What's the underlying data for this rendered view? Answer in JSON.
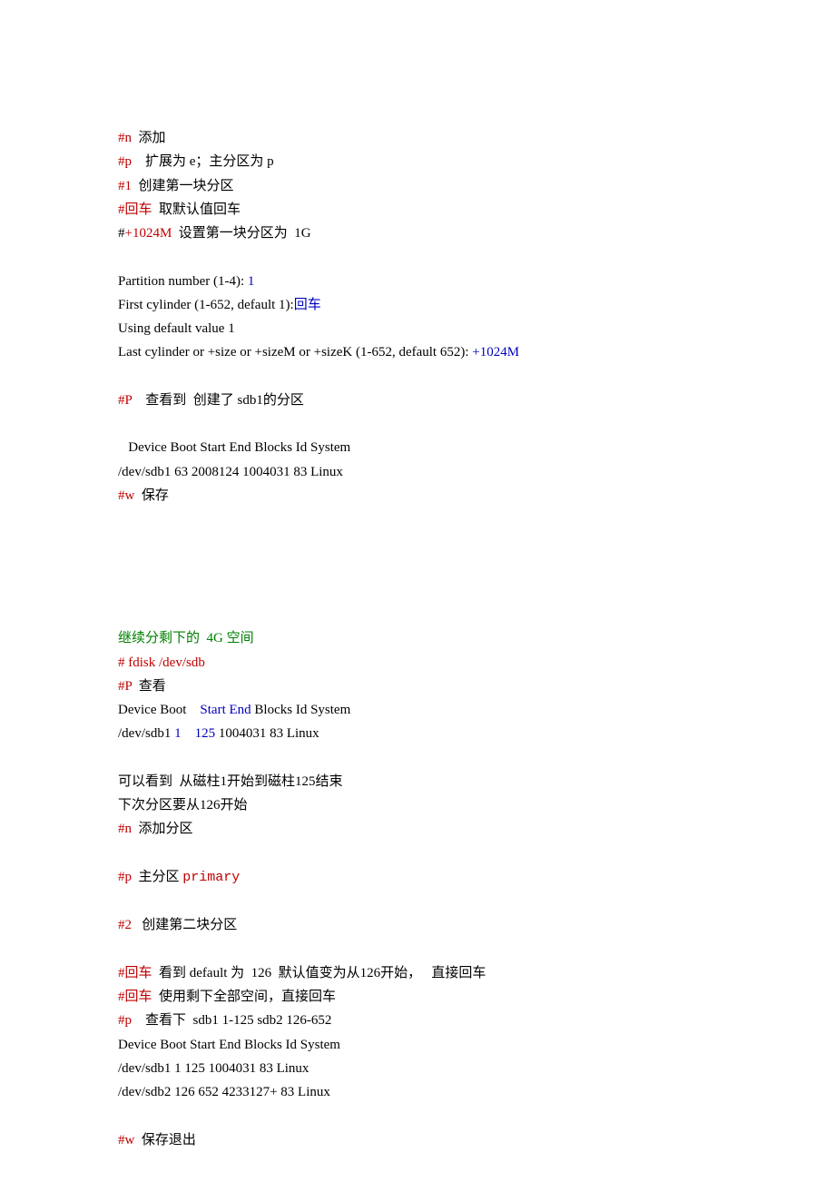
{
  "l1a": "#n",
  "l1b": "  添加",
  "l2a": "#p",
  "l2b": "    扩展为 e；主分区为 p",
  "l3a": "#1",
  "l3b": "  创建第一块分区",
  "l4a": "#回车",
  "l4b": "  取默认值回车",
  "l5a": "#",
  "l5b": "+1024M",
  "l5c": "  设置第一块分区为  1G",
  "l6a": "Partition number (1-4): ",
  "l6b": "1",
  "l7a": "First cylinder (1-652, default 1):",
  "l7b": "回车",
  "l8": "Using default value 1",
  "l9a": "Last cylinder or +size or +sizeM or +sizeK (1-652, default 652): ",
  "l9b": "+1024M",
  "l10a": "#P",
  "l10b": "    查看到  创建了 sdb1的分区",
  "l11": "   Device Boot Start End Blocks Id System",
  "l12": "/dev/sdb1 63 2008124 1004031 83 Linux",
  "l13a": "#w",
  "l13b": "  保存",
  "l14": "继续分剩下的  4G 空间",
  "l15": "# fdisk /dev/sdb",
  "l16a": "#P",
  "l16b": "  查看",
  "l17a": "Device Boot    ",
  "l17b": "Start End",
  "l17c": " Blocks Id System",
  "l18a": "/dev/sdb1 ",
  "l18b": "1    125",
  "l18c": " 1004031 83 Linux",
  "l19": "可以看到  从磁柱1开始到磁柱125结束",
  "l20": "下次分区要从126开始",
  "l21a": "#n",
  "l21b": "  添加分区",
  "l22a": "#p",
  "l22b": "  主分区 ",
  "l22c": "primary",
  "l23a": "#2",
  "l23b": "   创建第二块分区",
  "l24a": "#回车",
  "l24b": "  看到 default 为  126  默认值变为从126开始，",
  "l24c": "   直接回车",
  "l25a": "#回车",
  "l25b": "  使用剩下全部空间，直接回车",
  "l26a": "#p",
  "l26b": "    查看下  sdb1 1-125 sdb2 126-652",
  "l27": "Device Boot Start End Blocks Id System",
  "l28": "/dev/sdb1 1 125 1004031 83 Linux",
  "l29": "/dev/sdb2 126 652 4233127+ 83 Linux",
  "l30a": "#w",
  "l30b": "  保存退出"
}
